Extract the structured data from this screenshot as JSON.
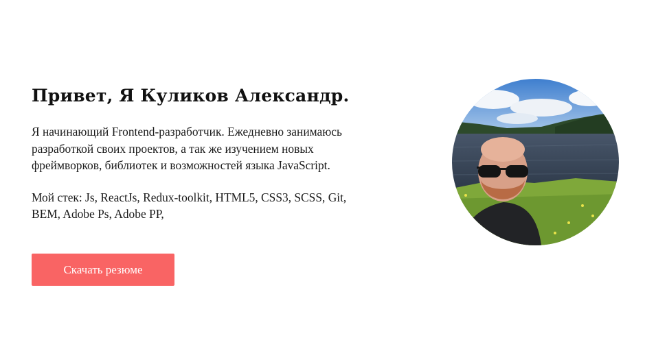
{
  "hero": {
    "title": "Привет, Я Куликов Александр.",
    "intro": "Я начинающий Frontend-разработчик. Ежедневно занимаюсь разработкой своих проектов, а так же изучением новых фреймворков, библиотек и возможностей языка JavaScript.",
    "stack": "Мой стек: Js, ReactJs, Redux-toolkit, HTML5, CSS3, SCSS, Git, BEM, Adobe Ps, Adobe PP,"
  },
  "actions": {
    "resume_label": "Скачать резюме"
  },
  "colors": {
    "accent": "#f96464",
    "text": "#111111",
    "background": "#ffffff"
  }
}
